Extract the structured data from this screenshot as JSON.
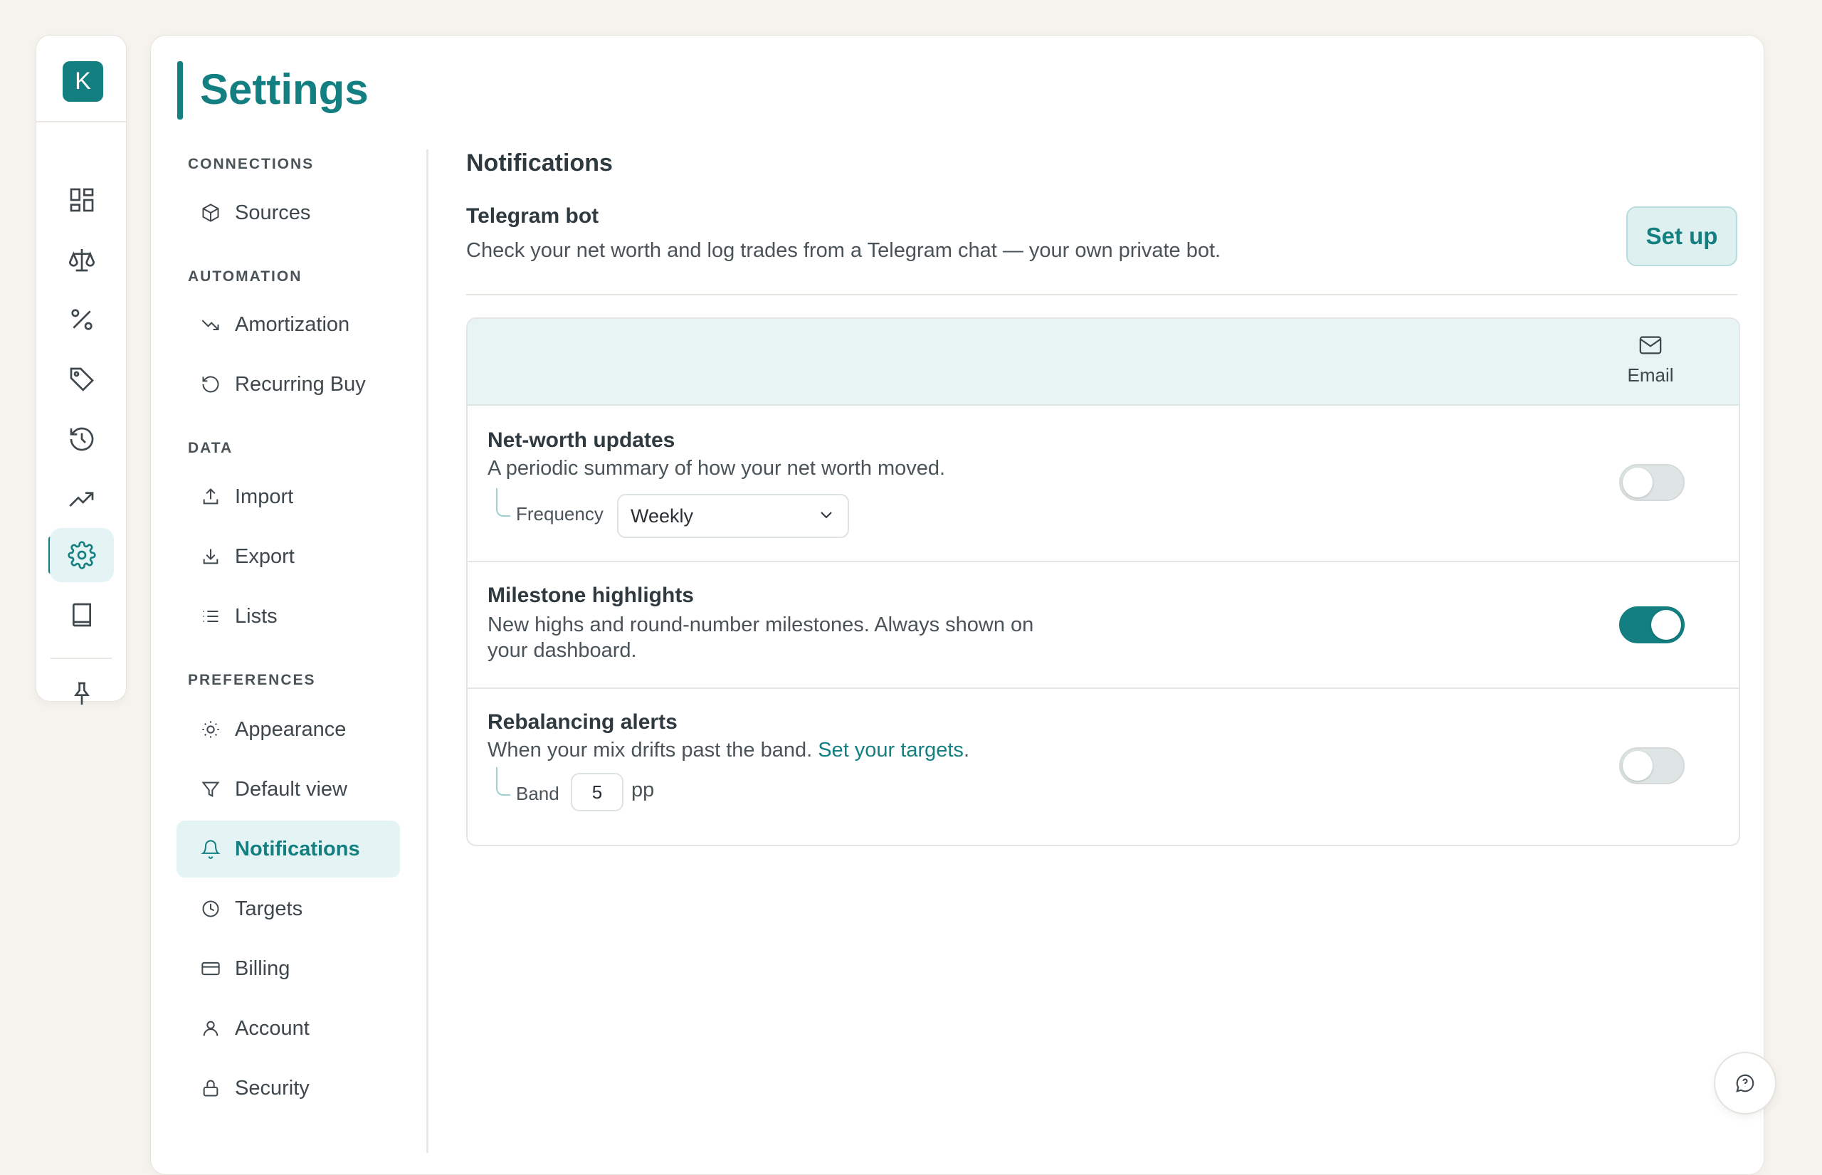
{
  "app": {
    "logo_letter": "K",
    "brand_color": "#137f80"
  },
  "rail": {
    "items": [
      {
        "icon": "dashboard-icon"
      },
      {
        "icon": "scale-icon"
      },
      {
        "icon": "percent-icon"
      },
      {
        "icon": "tag-icon"
      },
      {
        "icon": "history-icon"
      },
      {
        "icon": "trending-up-icon"
      },
      {
        "icon": "gear-icon",
        "active": true
      },
      {
        "icon": "book-icon"
      },
      {
        "icon": "pin-icon"
      }
    ]
  },
  "page": {
    "title": "Settings"
  },
  "nav": {
    "sections": [
      {
        "label": "CONNECTIONS",
        "items": [
          {
            "label": "Sources",
            "icon": "cube-icon"
          }
        ]
      },
      {
        "label": "AUTOMATION",
        "items": [
          {
            "label": "Amortization",
            "icon": "trending-down-icon"
          },
          {
            "label": "Recurring Buy",
            "icon": "refresh-icon"
          }
        ]
      },
      {
        "label": "DATA",
        "items": [
          {
            "label": "Import",
            "icon": "upload-icon"
          },
          {
            "label": "Export",
            "icon": "download-icon"
          },
          {
            "label": "Lists",
            "icon": "list-icon"
          }
        ]
      },
      {
        "label": "PREFERENCES",
        "items": [
          {
            "label": "Appearance",
            "icon": "sun-icon"
          },
          {
            "label": "Default view",
            "icon": "filter-icon"
          },
          {
            "label": "Notifications",
            "icon": "bell-icon",
            "active": true
          },
          {
            "label": "Targets",
            "icon": "clock-icon"
          },
          {
            "label": "Billing",
            "icon": "card-icon"
          },
          {
            "label": "Account",
            "icon": "user-icon"
          },
          {
            "label": "Security",
            "icon": "lock-icon"
          }
        ]
      }
    ]
  },
  "notifications": {
    "title": "Notifications",
    "telegram": {
      "title": "Telegram bot",
      "description": "Check your net worth and log trades from a Telegram chat — your own private bot.",
      "button": "Set up"
    },
    "table": {
      "channel_label": "Email",
      "channel_icon": "mail-icon",
      "rows": [
        {
          "title": "Net-worth updates",
          "description": "A periodic summary of how your net worth moved.",
          "sub_label": "Frequency",
          "select_value": "Weekly",
          "enabled": false
        },
        {
          "title": "Milestone highlights",
          "description_line1": "New highs and round-number milestones. Always shown on",
          "description_line2": "your dashboard.",
          "enabled": true
        },
        {
          "title": "Rebalancing alerts",
          "description": "When your mix drifts past the band.",
          "link": "Set your targets",
          "link_suffix": ".",
          "sub_label": "Band",
          "band_value": "5",
          "band_unit": "pp",
          "enabled": false
        }
      ]
    }
  },
  "help": {
    "icon": "help-chat-icon"
  }
}
